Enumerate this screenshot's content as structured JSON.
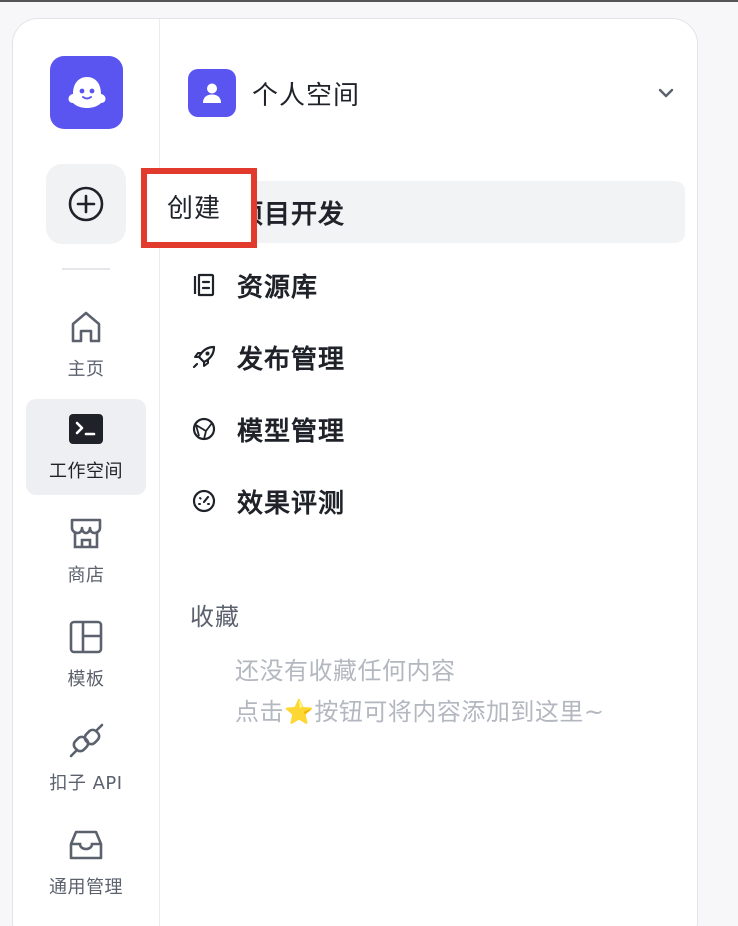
{
  "app": {
    "brand_color": "#5a55f0",
    "logo_icon": "ghost-logo-icon"
  },
  "rail": {
    "create": {
      "icon": "plus-circle-icon",
      "tooltip": "创建"
    },
    "items": [
      {
        "label": "主页",
        "icon": "home-icon",
        "active": false
      },
      {
        "label": "工作空间",
        "icon": "terminal-icon",
        "active": true
      },
      {
        "label": "商店",
        "icon": "store-icon",
        "active": false
      },
      {
        "label": "模板",
        "icon": "template-icon",
        "active": false
      },
      {
        "label": "扣子 API",
        "icon": "plug-icon",
        "active": false
      },
      {
        "label": "通用管理",
        "icon": "inbox-icon",
        "active": false
      }
    ]
  },
  "space": {
    "name": "个人空间",
    "icon": "user-icon",
    "dropdown_icon": "chevron-down-icon"
  },
  "nav": {
    "items": [
      {
        "label": "项目开发",
        "icon": "project-icon",
        "active": true
      },
      {
        "label": "资源库",
        "icon": "library-icon",
        "active": false
      },
      {
        "label": "发布管理",
        "icon": "rocket-icon",
        "active": false
      },
      {
        "label": "模型管理",
        "icon": "model-icon",
        "active": false
      },
      {
        "label": "效果评测",
        "icon": "gauge-icon",
        "active": false
      }
    ]
  },
  "favorites": {
    "title": "收藏",
    "empty_line1": "还没有收藏任何内容",
    "empty_line2": "点击⭐按钮可将内容添加到这里~"
  },
  "annotation": {
    "highlight_color": "#e23a2c"
  }
}
